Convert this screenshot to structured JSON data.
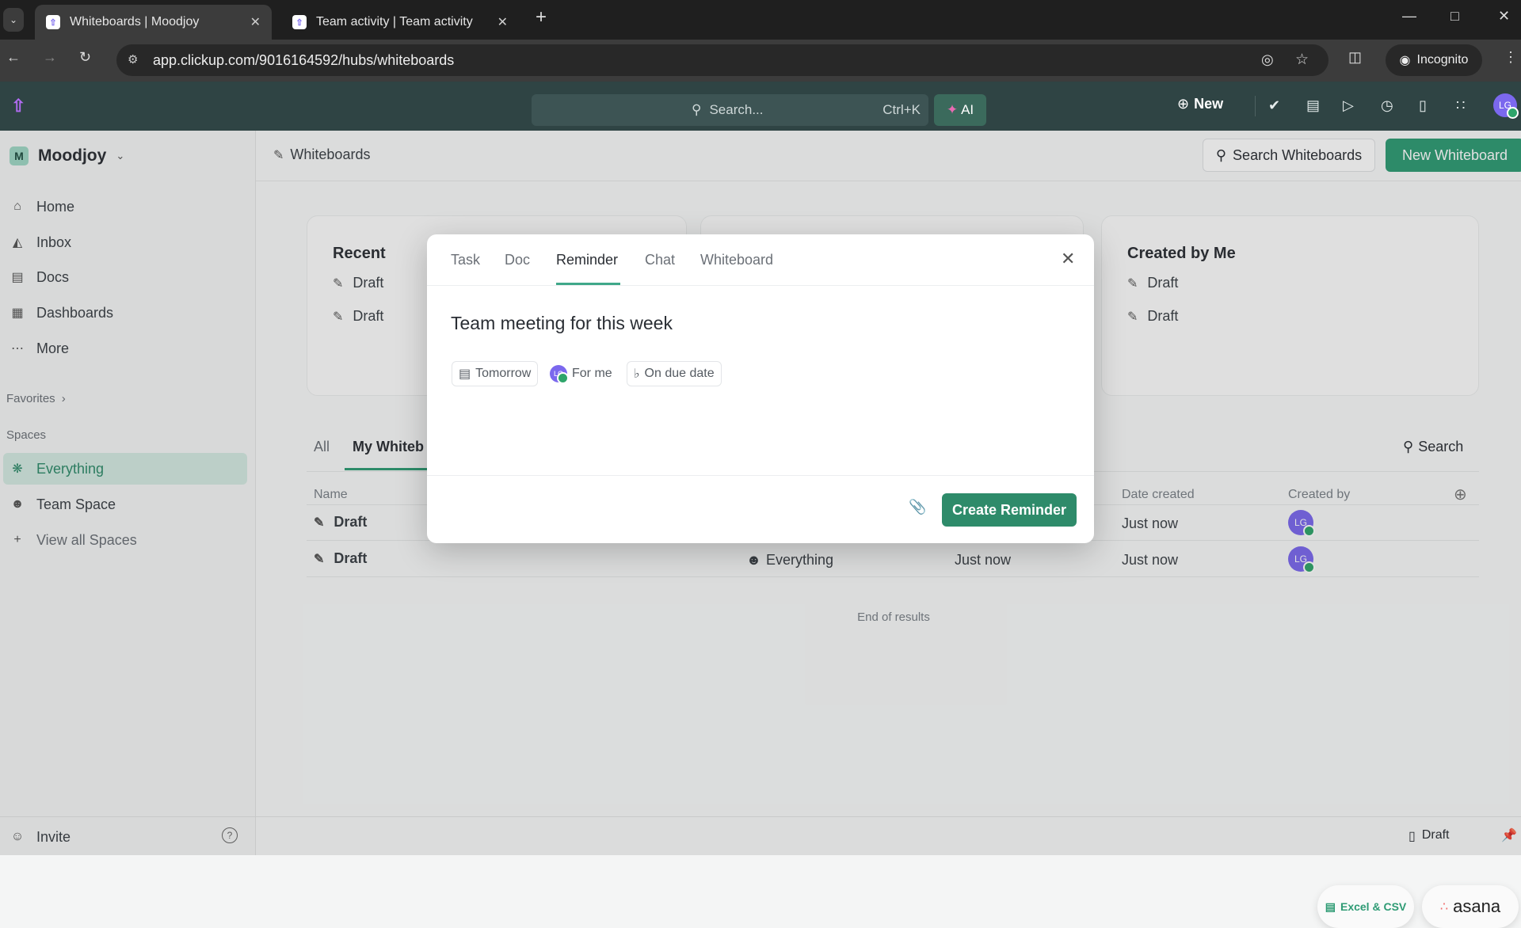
{
  "browser": {
    "tabs": [
      {
        "title": "Whiteboards | Moodjoy",
        "active": true
      },
      {
        "title": "Team activity | Team activity",
        "active": false
      }
    ],
    "url": "app.clickup.com/9016164592/hubs/whiteboards",
    "incognito_label": "Incognito"
  },
  "topbar": {
    "search_placeholder": "Search...",
    "shortcut": "Ctrl+K",
    "ai_label": "AI",
    "new_label": "New",
    "avatar": "LG"
  },
  "sidebar": {
    "workspace_initial": "M",
    "workspace": "Moodjoy",
    "items": [
      {
        "label": "Home",
        "icon": "home-icon"
      },
      {
        "label": "Inbox",
        "icon": "inbox-icon"
      },
      {
        "label": "Docs",
        "icon": "docs-icon"
      },
      {
        "label": "Dashboards",
        "icon": "dashboards-icon"
      },
      {
        "label": "More",
        "icon": "more-icon"
      }
    ],
    "favorites": "Favorites",
    "spaces_label": "Spaces",
    "spaces": [
      {
        "label": "Everything",
        "active": true
      },
      {
        "label": "Team Space"
      },
      {
        "label": "View all Spaces"
      }
    ],
    "invite": "Invite"
  },
  "header": {
    "breadcrumb": "Whiteboards",
    "search_button": "Search Whiteboards",
    "new_button": "New Whiteboard"
  },
  "cards": {
    "recent": {
      "title": "Recent",
      "items": [
        "Draft",
        "Draft"
      ]
    },
    "created_by_me": {
      "title": "Created by Me",
      "items": [
        "Draft",
        "Draft"
      ]
    }
  },
  "list": {
    "tabs": [
      "All",
      "My Whiteb"
    ],
    "search": "Search",
    "columns": {
      "name": "Name",
      "date_created": "Date created",
      "created_by": "Created by"
    },
    "rows": [
      {
        "name": "Draft",
        "location": "",
        "date_updated": "",
        "date_created": "Just now",
        "created_by": "LG"
      },
      {
        "name": "Draft",
        "location": "Everything",
        "date_updated": "Just now",
        "date_created": "Just now",
        "created_by": "LG"
      }
    ],
    "end": "End of results"
  },
  "modal": {
    "tabs": [
      "Task",
      "Doc",
      "Reminder",
      "Chat",
      "Whiteboard"
    ],
    "active_tab": "Reminder",
    "title": "Team meeting for this week",
    "chips": {
      "date": "Tomorrow",
      "assignee_avatar": "LG",
      "assignee": "For me",
      "notify": "On due date"
    },
    "submit": "Create Reminder"
  },
  "imports": {
    "excel": "Excel & CSV",
    "asana": "asana"
  },
  "footer": {
    "draft": "Draft"
  },
  "colors": {
    "accent": "#2e8b6a",
    "brand_purple": "#7b68ee",
    "topbar": "#2f4444"
  }
}
